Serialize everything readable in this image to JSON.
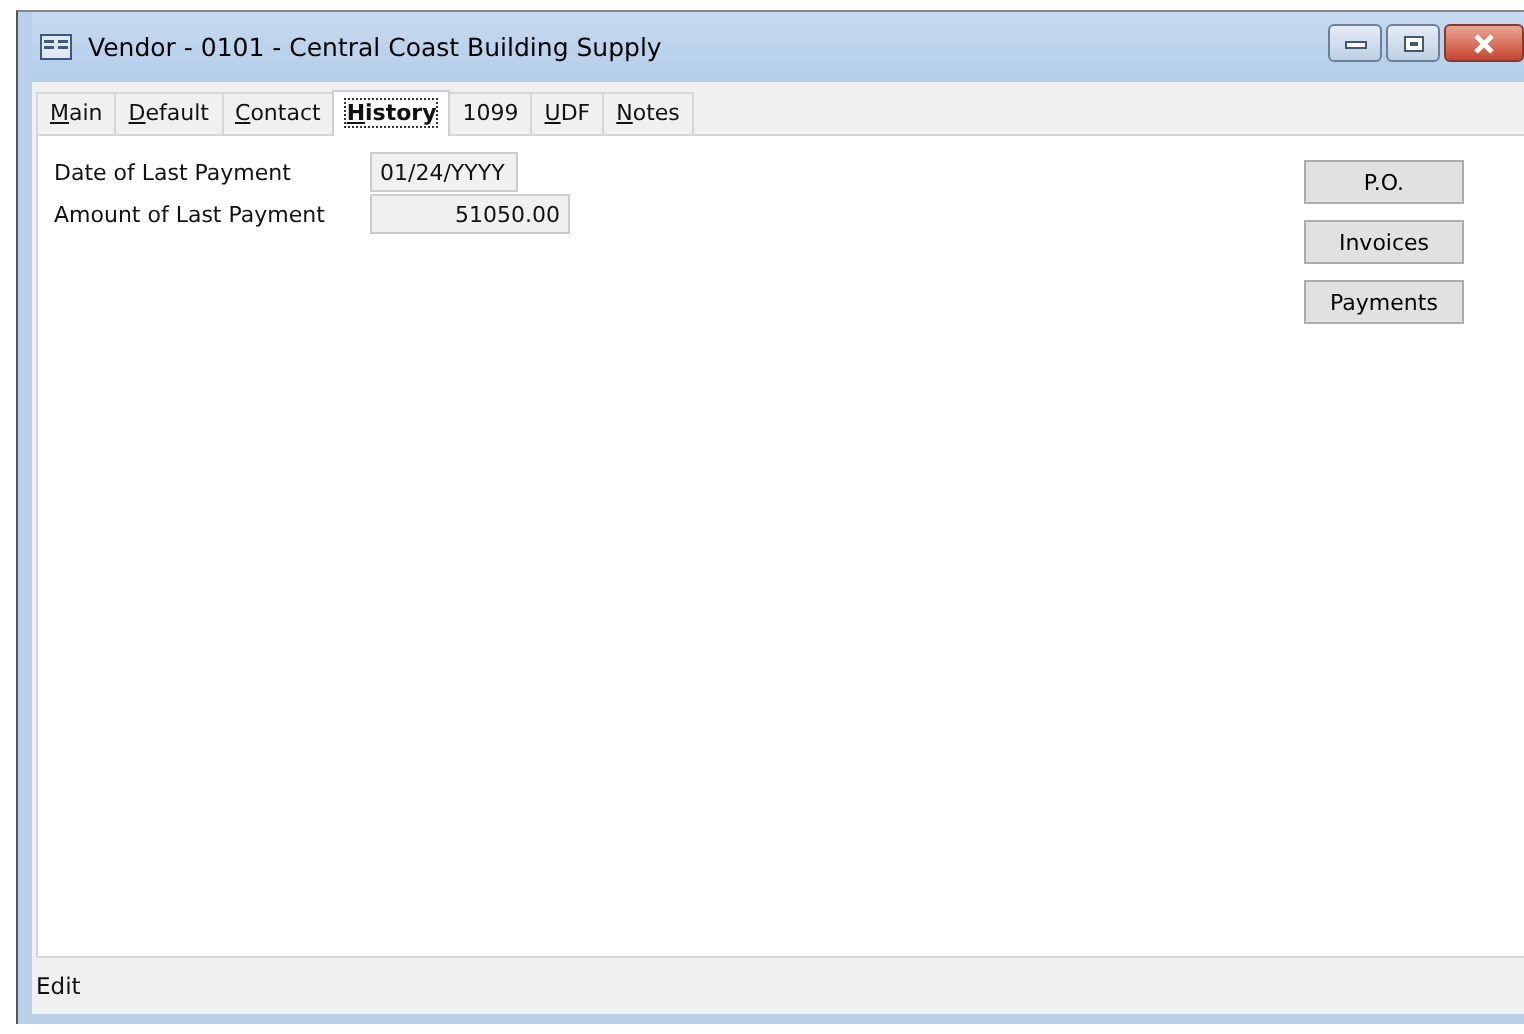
{
  "window": {
    "title": "Vendor - 0101 - Central Coast Building Supply"
  },
  "tabs": [
    {
      "key": "M",
      "rest": "ain",
      "selected": false
    },
    {
      "key": "D",
      "rest": "efault",
      "selected": false
    },
    {
      "key": "C",
      "rest": "ontact",
      "selected": false
    },
    {
      "key": "H",
      "rest": "istory",
      "selected": true
    },
    {
      "rest": "1099",
      "selected": false
    },
    {
      "key": "U",
      "rest": "DF",
      "selected": false
    },
    {
      "key": "N",
      "rest": "otes",
      "selected": false
    }
  ],
  "fields": [
    {
      "label": "Date of Last Payment",
      "value": "01/24/YYYY",
      "kind": "date"
    },
    {
      "label": "Amount of Last Payment",
      "value": "51050.00",
      "kind": "amount"
    }
  ],
  "buttons": [
    "P.O.",
    "Invoices",
    "Payments"
  ],
  "status_bar": "Edit"
}
